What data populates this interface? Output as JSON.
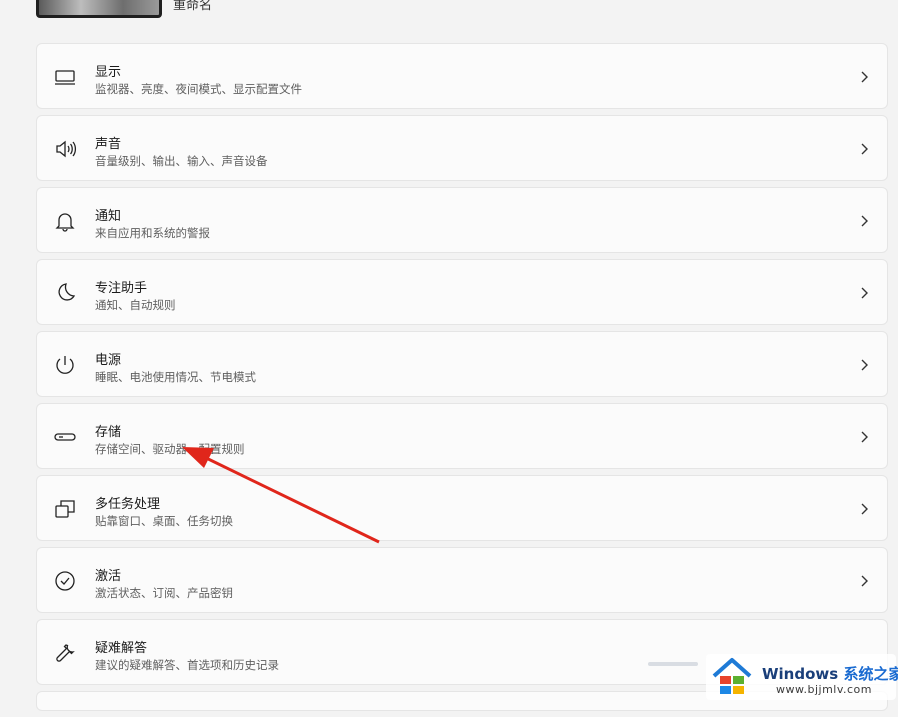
{
  "header": {
    "rename_label": "重命名"
  },
  "settings": [
    {
      "title": "显示",
      "subtitle": "监视器、亮度、夜间模式、显示配置文件",
      "icon": "monitor-icon"
    },
    {
      "title": "声音",
      "subtitle": "音量级别、输出、输入、声音设备",
      "icon": "speaker-icon"
    },
    {
      "title": "通知",
      "subtitle": "来自应用和系统的警报",
      "icon": "bell-icon"
    },
    {
      "title": "专注助手",
      "subtitle": "通知、自动规则",
      "icon": "moon-icon"
    },
    {
      "title": "电源",
      "subtitle": "睡眠、电池使用情况、节电模式",
      "icon": "power-icon"
    },
    {
      "title": "存储",
      "subtitle": "存储空间、驱动器、配置规则",
      "icon": "storage-drive-icon"
    },
    {
      "title": "多任务处理",
      "subtitle": "贴靠窗口、桌面、任务切换",
      "icon": "multitasking-icon"
    },
    {
      "title": "激活",
      "subtitle": "激活状态、订阅、产品密钥",
      "icon": "check-circle-icon"
    },
    {
      "title": "疑难解答",
      "subtitle": "建议的疑难解答、首选项和历史记录",
      "icon": "wrench-icon"
    }
  ],
  "watermark": {
    "brand": "Windows",
    "brand_cn": "系统之家",
    "url": "www.bjjmlv.com"
  },
  "colors": {
    "annotation_arrow": "#e0261b",
    "watermark_text": "#1a3f7a"
  }
}
